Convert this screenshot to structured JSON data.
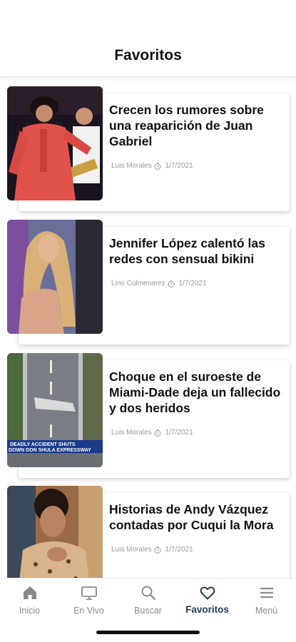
{
  "header": {
    "title": "Favoritos"
  },
  "articles": [
    {
      "title": "Crecen los rumores sobre una reaparición de Juan Gabriel",
      "author": "Luis Morales",
      "date": "1/7/2021"
    },
    {
      "title": "Jennifer López calentó las redes con sensual bikini",
      "author": "Lino Colmenarez",
      "date": "1/7/2021"
    },
    {
      "title": "Choque en el suroeste de Miami-Dade deja un fallecido y dos heridos",
      "author": "Luis Morales",
      "date": "1/7/2021",
      "image_caption": [
        "DEADLY ACCIDENT SHUTS",
        "DOWN DON SHULA EXPRESSWAY"
      ]
    },
    {
      "title": "Historias de Andy Vázquez contadas por Cuqui la Mora",
      "author": "Luis Morales",
      "date": "1/7/2021"
    }
  ],
  "tabbar": {
    "active_color": "#1f3c5c",
    "inactive_color": "#8a8a8a",
    "items": [
      {
        "label": "Inicio",
        "icon": "home-icon"
      },
      {
        "label": "En Vivo",
        "icon": "tv-icon"
      },
      {
        "label": "Buscar",
        "icon": "search-icon"
      },
      {
        "label": "Favoritos",
        "icon": "heart-icon",
        "active": true
      },
      {
        "label": "Menú",
        "icon": "menu-icon"
      }
    ]
  }
}
